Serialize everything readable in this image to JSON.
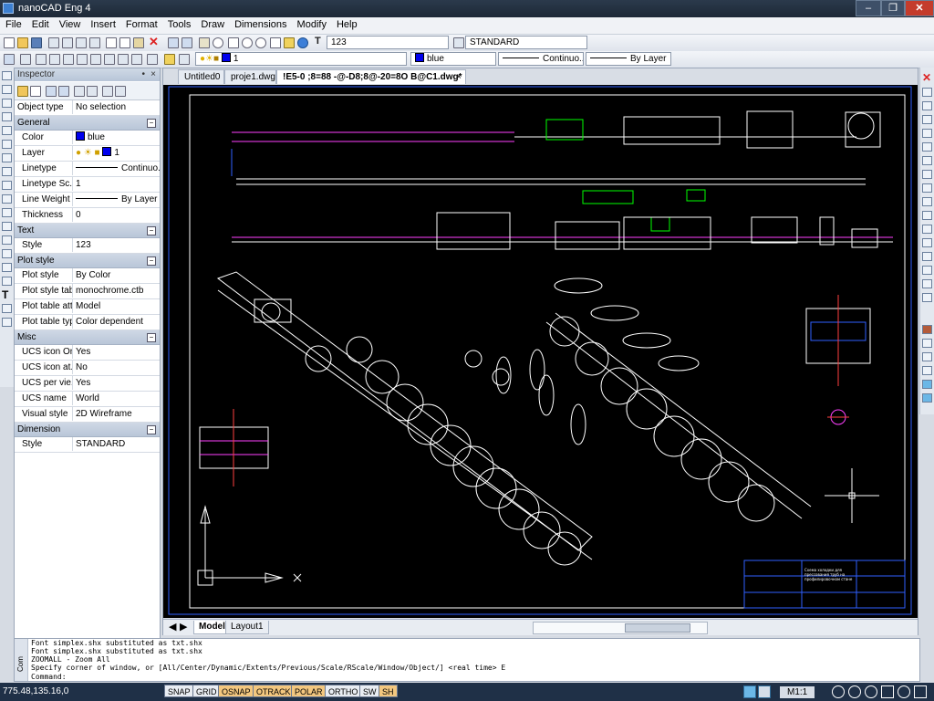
{
  "window": {
    "title": "nanoCAD Eng 4"
  },
  "menu": [
    "File",
    "Edit",
    "View",
    "Insert",
    "Format",
    "Tools",
    "Draw",
    "Dimensions",
    "Modify",
    "Help"
  ],
  "toolbar": {
    "text_style": "123",
    "dim_style": "STANDARD",
    "layer": "1",
    "color": "blue",
    "linetype": "Continuo...",
    "lineweight": "By Layer"
  },
  "inspector": {
    "title": "Inspector",
    "object_type_label": "Object type",
    "object_type_value": "No selection",
    "categories": [
      {
        "name": "General",
        "rows": [
          {
            "k": "Color",
            "v": "blue"
          },
          {
            "k": "Layer",
            "v": "1"
          },
          {
            "k": "Linetype",
            "v": "Continuo..."
          },
          {
            "k": "Linetype Sc...",
            "v": "1"
          },
          {
            "k": "Line Weight",
            "v": "By Layer"
          },
          {
            "k": "Thickness",
            "v": "0"
          }
        ]
      },
      {
        "name": "Text",
        "rows": [
          {
            "k": "Style",
            "v": "123"
          }
        ]
      },
      {
        "name": "Plot style",
        "rows": [
          {
            "k": "Plot style",
            "v": "By Color"
          },
          {
            "k": "Plot style tab...",
            "v": "monochrome.ctb"
          },
          {
            "k": "Plot table att...",
            "v": "Model"
          },
          {
            "k": "Plot table type",
            "v": "Color dependent"
          }
        ]
      },
      {
        "name": "Misc",
        "rows": [
          {
            "k": "UCS icon On",
            "v": "Yes"
          },
          {
            "k": "UCS icon at...",
            "v": "No"
          },
          {
            "k": "UCS per vie...",
            "v": "Yes"
          },
          {
            "k": "UCS name",
            "v": "World"
          },
          {
            "k": "Visual style",
            "v": "2D Wireframe"
          }
        ]
      },
      {
        "name": "Dimension",
        "rows": [
          {
            "k": "Style",
            "v": "STANDARD"
          }
        ]
      }
    ]
  },
  "tabs": [
    "Untitled0",
    "proje1.dwg*",
    "!E5-0 ;8=88 -@-D8;8@-20=8O B@C1.dwg*"
  ],
  "layout_tabs": [
    "Model",
    "Layout1"
  ],
  "title_block_text": "Схема холодки для\nпрессования труб на\nпрофилировочном стане",
  "command": {
    "lines": [
      "Font simplex.shx substituted as txt.shx",
      "Font simplex.shx substituted as txt.shx",
      "ZOOMALL - Zoom All",
      "Specify corner of window, or [All/Center/Dynamic/Extents/Previous/Scale/RScale/Window/Object/] <real time> E"
    ],
    "prompt": "Command:",
    "side_label": "Com"
  },
  "status": {
    "coords": "775.48,135.16,0",
    "buttons": [
      {
        "label": "SNAP",
        "on": false
      },
      {
        "label": "GRID",
        "on": false
      },
      {
        "label": "OSNAP",
        "on": true
      },
      {
        "label": "OTRACK",
        "on": true
      },
      {
        "label": "POLAR",
        "on": true
      },
      {
        "label": "ORTHO",
        "on": false
      },
      {
        "label": "SW",
        "on": false
      },
      {
        "label": "SH",
        "on": true
      }
    ],
    "scale": "M1:1"
  },
  "colors": {
    "accent": "#0000ee",
    "canvas": "#000000",
    "drawing": "#ffffff",
    "magenta": "#ff40ff",
    "frame": "#3060ff"
  }
}
